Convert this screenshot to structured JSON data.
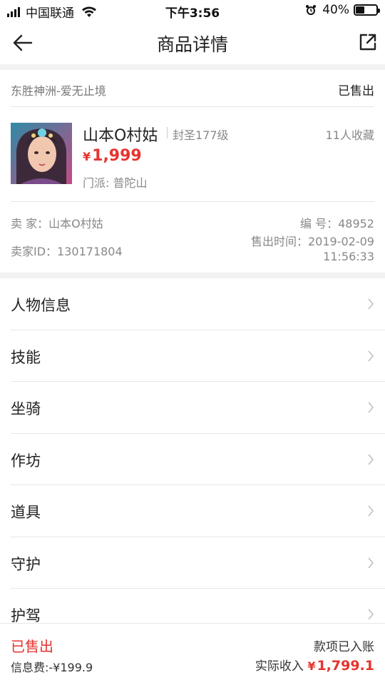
{
  "status_bar": {
    "carrier": "中国联通",
    "time": "下午3:56",
    "battery": "40%",
    "battery_level": 0.4
  },
  "nav": {
    "title": "商品详情",
    "back_icon": "arrow-left-icon",
    "share_icon": "share-external-icon"
  },
  "product": {
    "server": "东胜神洲-爱无止境",
    "sale_status": "已售出",
    "char_name": "山本O村姑",
    "level": "封圣177级",
    "favorites": "11人收藏",
    "price_currency": "¥",
    "price": "1,999",
    "school": "门派: 普陀山",
    "seller": "卖  家：山本O村姑",
    "seller_id": "卖家ID：130171804",
    "item_no": "编  号：48952",
    "sold_time_label": "售出时间：2019-02-09",
    "sold_time_clock": "11:56:33"
  },
  "menu": {
    "items": [
      {
        "label": "人物信息"
      },
      {
        "label": "技能"
      },
      {
        "label": "坐骑"
      },
      {
        "label": "作坊"
      },
      {
        "label": "道具"
      },
      {
        "label": "守护"
      },
      {
        "label": "护驾"
      }
    ]
  },
  "footer": {
    "status": "已售出",
    "fee": "信息费:-¥199.9",
    "credited": "款项已入账",
    "income_label": "实际收入",
    "income_currency": "¥",
    "income_value": "1,799.1"
  },
  "colors": {
    "accent_red": "#e5342f",
    "muted_text": "#888888",
    "divider": "#e6e6e6",
    "section_gap": "#f2f2f2"
  }
}
